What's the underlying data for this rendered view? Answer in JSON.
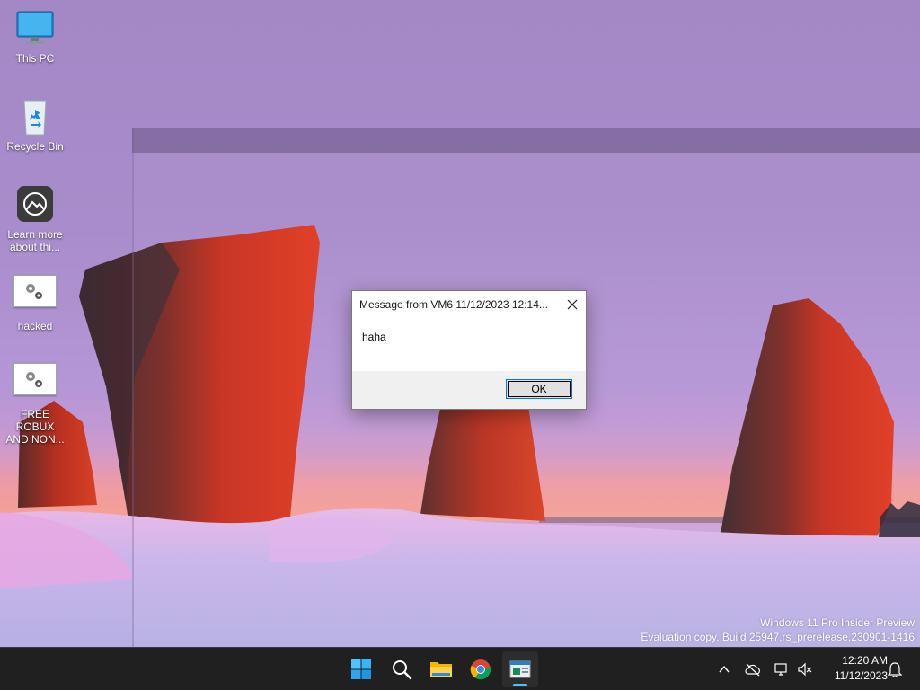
{
  "desktop": {
    "icons": [
      {
        "label": "This PC"
      },
      {
        "label": "Recycle Bin"
      },
      {
        "label_line1": "Learn more",
        "label_line2": "about thi..."
      },
      {
        "label": "hacked"
      },
      {
        "label_line1": "FREE ROBUX",
        "label_line2": "AND NON..."
      }
    ],
    "watermark": {
      "line1": "Windows 11 Pro Insider Preview",
      "line2": "Evaluation copy. Build 25947.rs_prerelease.230901-1416"
    }
  },
  "dialog": {
    "title": "Message from VM6 11/12/2023 12:14...",
    "message": "haha",
    "ok_label": "OK"
  },
  "taskbar": {
    "apps": [
      "start-icon",
      "search-icon",
      "file-explorer-icon",
      "chrome-icon",
      "message-app-icon"
    ],
    "tray": [
      "chevron-up-icon",
      "cloud-offline-icon",
      "network-icon",
      "volume-muted-icon",
      "notification-bell-icon"
    ],
    "time": "12:20 AM",
    "date": "11/12/2023"
  },
  "colors": {
    "taskbar_bg": "#202020",
    "accent": "#4cc2ff",
    "dialog_footer": "#f0f0f0"
  }
}
